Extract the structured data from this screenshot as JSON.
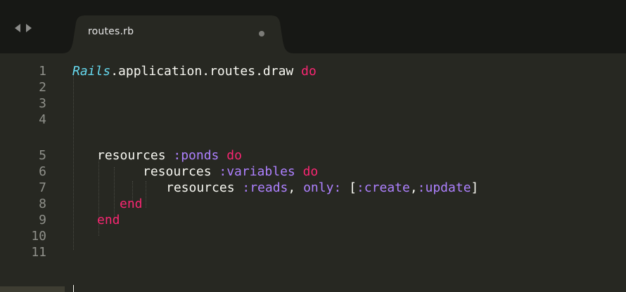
{
  "tabs": [
    {
      "title": "routes.rb",
      "modified": true
    }
  ],
  "line_numbers": [
    "1",
    "2",
    "3",
    "4",
    "5",
    "6",
    "7",
    "8",
    "9",
    "10",
    "11"
  ],
  "code_lines": [
    [
      {
        "t": "Rails",
        "k": "const"
      },
      {
        "t": ".application.routes.draw ",
        "k": "plain"
      },
      {
        "t": "do",
        "k": "kw"
      }
    ],
    [],
    [],
    [],
    [
      {
        "t": "resources ",
        "k": "plain"
      },
      {
        "t": ":ponds",
        "k": "sym"
      },
      {
        "t": " ",
        "k": "plain"
      },
      {
        "t": "do",
        "k": "kw"
      }
    ],
    [
      {
        "t": "resources ",
        "k": "plain"
      },
      {
        "t": ":variables",
        "k": "sym"
      },
      {
        "t": " ",
        "k": "plain"
      },
      {
        "t": "do",
        "k": "kw"
      }
    ],
    [
      {
        "t": "resources ",
        "k": "plain"
      },
      {
        "t": ":reads",
        "k": "sym"
      },
      {
        "t": ", ",
        "k": "plain"
      },
      {
        "t": "only:",
        "k": "sym"
      },
      {
        "t": " [",
        "k": "plain"
      },
      {
        "t": ":create",
        "k": "sym"
      },
      {
        "t": ",",
        "k": "plain"
      },
      {
        "t": ":update",
        "k": "sym"
      },
      {
        "t": "]",
        "k": "plain"
      }
    ],
    [
      {
        "t": "end",
        "k": "kw"
      }
    ],
    [
      {
        "t": "end",
        "k": "kw"
      }
    ],
    [],
    []
  ],
  "colors": {
    "background": "#272822",
    "tabbar": "#171815",
    "keyword": "#f92672",
    "symbol": "#ae81ff",
    "constant": "#66d9ef",
    "text": "#f8f8f2",
    "line_number": "#8f908a"
  },
  "icons": {
    "back": "triangle-left-icon",
    "forward": "triangle-right-icon",
    "dirty": "modified-dot-icon"
  }
}
